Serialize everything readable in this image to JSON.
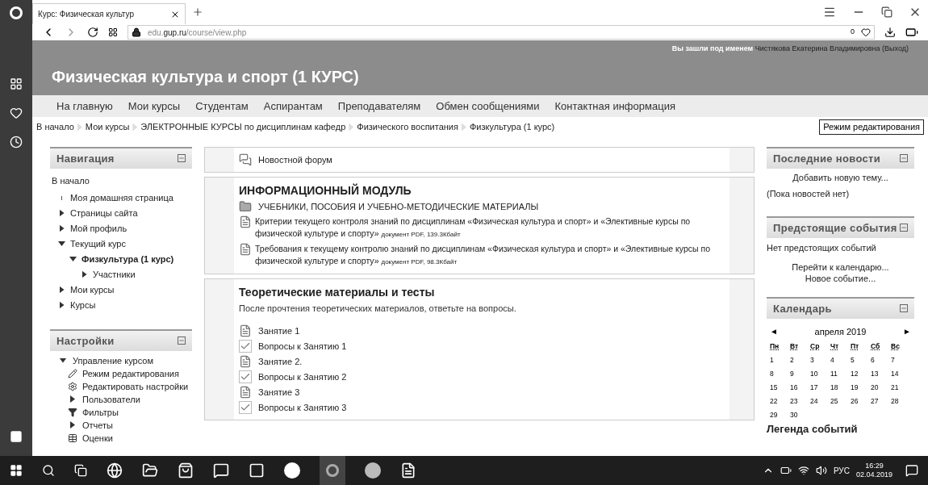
{
  "browser": {
    "tab_title": "Курс: Физическая культур",
    "url": "edu.**gup.ru**/course/view.php",
    "badge": "0"
  },
  "header": {
    "login_text": "Вы зашли под именем",
    "user_name": "Чистякова Екатерина Владимировна",
    "logout": "(Выход)",
    "course_title": "Физическая культура и спорт (1 КУРС)"
  },
  "menu": [
    "На главную",
    "Мои курсы",
    "Студентам",
    "Аспирантам",
    "Преподавателям",
    "Обмен сообщениями",
    "Контактная информация"
  ],
  "breadcrumbs": [
    "В начало",
    "Мои курсы",
    "ЭЛЕКТРОННЫЕ КУРСЫ по дисциплинам кафедр",
    "Физического воспитания",
    "Физкультура (1 курс)"
  ],
  "edit_button": "Режим редактирования",
  "navigation": {
    "title": "Навигация",
    "home": "В начало",
    "items": [
      {
        "label": "Моя домашняя страница",
        "kind": "page",
        "active": false
      },
      {
        "label": "Страницы сайта",
        "kind": "branch",
        "expanded": false,
        "active": false
      },
      {
        "label": "Мой профиль",
        "kind": "branch",
        "expanded": false,
        "active": false
      },
      {
        "label": "Текущий курс",
        "kind": "branch",
        "expanded": true,
        "active": false,
        "children": [
          {
            "label": "Физкультура (1 курс)",
            "kind": "branch",
            "expanded": true,
            "active": true,
            "children": [
              {
                "label": "Участники",
                "kind": "branch",
                "expanded": false,
                "active": false
              }
            ]
          }
        ]
      },
      {
        "label": "Мои курсы",
        "kind": "branch",
        "expanded": false,
        "active": false
      },
      {
        "label": "Курсы",
        "kind": "branch",
        "expanded": false,
        "active": false
      }
    ]
  },
  "settings": {
    "title": "Настройки",
    "items": [
      {
        "label": "Управление курсом",
        "kind": "branch",
        "expanded": true,
        "children": [
          {
            "label": "Режим редактирования",
            "kind": "edit"
          },
          {
            "label": "Редактировать настройки",
            "kind": "gear"
          },
          {
            "label": "Пользователи",
            "kind": "branch",
            "expanded": false
          },
          {
            "label": "Фильтры",
            "kind": "filter"
          },
          {
            "label": "Отчеты",
            "kind": "branch",
            "expanded": false
          },
          {
            "label": "Оценки",
            "kind": "grades"
          }
        ]
      }
    ]
  },
  "sections": [
    {
      "activities": [
        {
          "kind": "forum",
          "label": "Новостной форум"
        }
      ]
    },
    {
      "title": "ИНФОРМАЦИОННЫЙ МОДУЛЬ",
      "activities": [
        {
          "kind": "folder",
          "label": "УЧЕБНИКИ, ПОСОБИЯ И УЧЕБНО-МЕТОДИЧЕСКИЕ МАТЕРИАЛЫ"
        },
        {
          "kind": "pdf",
          "label": "Критерии текущего контроля знаний по дисциплинам «Физическая культура и спорт» и «Элективные курсы по физической культуре и спорту»",
          "details": "документ PDF, 139.3Кбайт"
        },
        {
          "kind": "pdf",
          "label": "Требования к текущему контролю знаний по дисциплинам «Физическая культура и спорт» и «Элективные курсы по физической культуре и спорту»",
          "details": "документ PDF, 98.3Кбайт"
        }
      ]
    },
    {
      "title": "Теоретические материалы и тесты",
      "summary": "После прочтения теоретических материалов, ответьте на вопросы.",
      "activities": [
        {
          "kind": "page",
          "label": "Занятие 1"
        },
        {
          "kind": "quiz",
          "label": "Вопросы к Занятию 1"
        },
        {
          "kind": "page",
          "label": "Занятие 2."
        },
        {
          "kind": "quiz",
          "label": "Вопросы к Занятию 2"
        },
        {
          "kind": "page",
          "label": "Занятие 3"
        },
        {
          "kind": "quiz",
          "label": "Вопросы к Занятию 3"
        }
      ]
    }
  ],
  "news": {
    "title": "Последние новости",
    "add_link": "Добавить новую тему...",
    "empty": "(Пока новостей нет)"
  },
  "events": {
    "title": "Предстоящие события",
    "empty": "Нет предстоящих событий",
    "links": [
      "Перейти к календарю...",
      "Новое событие..."
    ]
  },
  "calendar": {
    "title": "Календарь",
    "prev": "◄",
    "month": "апреля 2019",
    "next": "►",
    "weekdays": [
      "Пн",
      "Вт",
      "Ср",
      "Чт",
      "Пт",
      "Сб",
      "Вс"
    ],
    "weeks": [
      [
        "1",
        "2",
        "3",
        "4",
        "5",
        "6",
        "7"
      ],
      [
        "8",
        "9",
        "10",
        "11",
        "12",
        "13",
        "14"
      ],
      [
        "15",
        "16",
        "17",
        "18",
        "19",
        "20",
        "21"
      ],
      [
        "22",
        "23",
        "24",
        "25",
        "26",
        "27",
        "28"
      ],
      [
        "29",
        "30"
      ]
    ],
    "legend_title": "Легенда событий"
  },
  "taskbar": {
    "language": "РУС",
    "time": "16:29",
    "date": "02.04.2019"
  }
}
